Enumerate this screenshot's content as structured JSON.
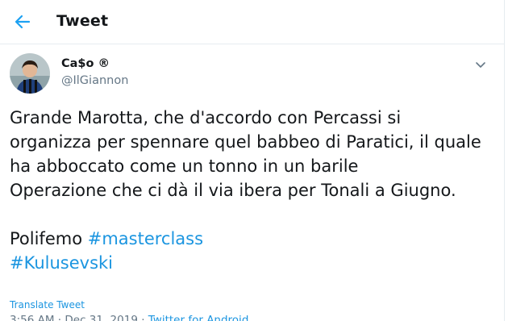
{
  "header": {
    "title": "Tweet",
    "back_icon": "arrow-left-icon",
    "accent_color": "#1da1f2"
  },
  "author": {
    "display_name": "Ca$o",
    "badge": "®",
    "username": "@IlGiannon",
    "avatar_icon": "user-avatar"
  },
  "tweet": {
    "lines": [
      "Grande Marotta, che d'accordo con Percassi si",
      "organizza per spennare quel babbeo di Paratici, il quale",
      "ha abboccato come un tonno in un barile",
      "Operazione che ci dà il via ibera per Tonali a Giugno."
    ],
    "tail_text": "Polifemo ",
    "hashtags": [
      "#masterclass",
      "#Kulusevski"
    ],
    "hashtag_color": "#1b95e0"
  },
  "translate_label": "Translate Tweet",
  "meta": {
    "time": "3:56 AM",
    "separator": " · ",
    "date": "Dec 31, 2019",
    "source": "Twitter for Android"
  }
}
